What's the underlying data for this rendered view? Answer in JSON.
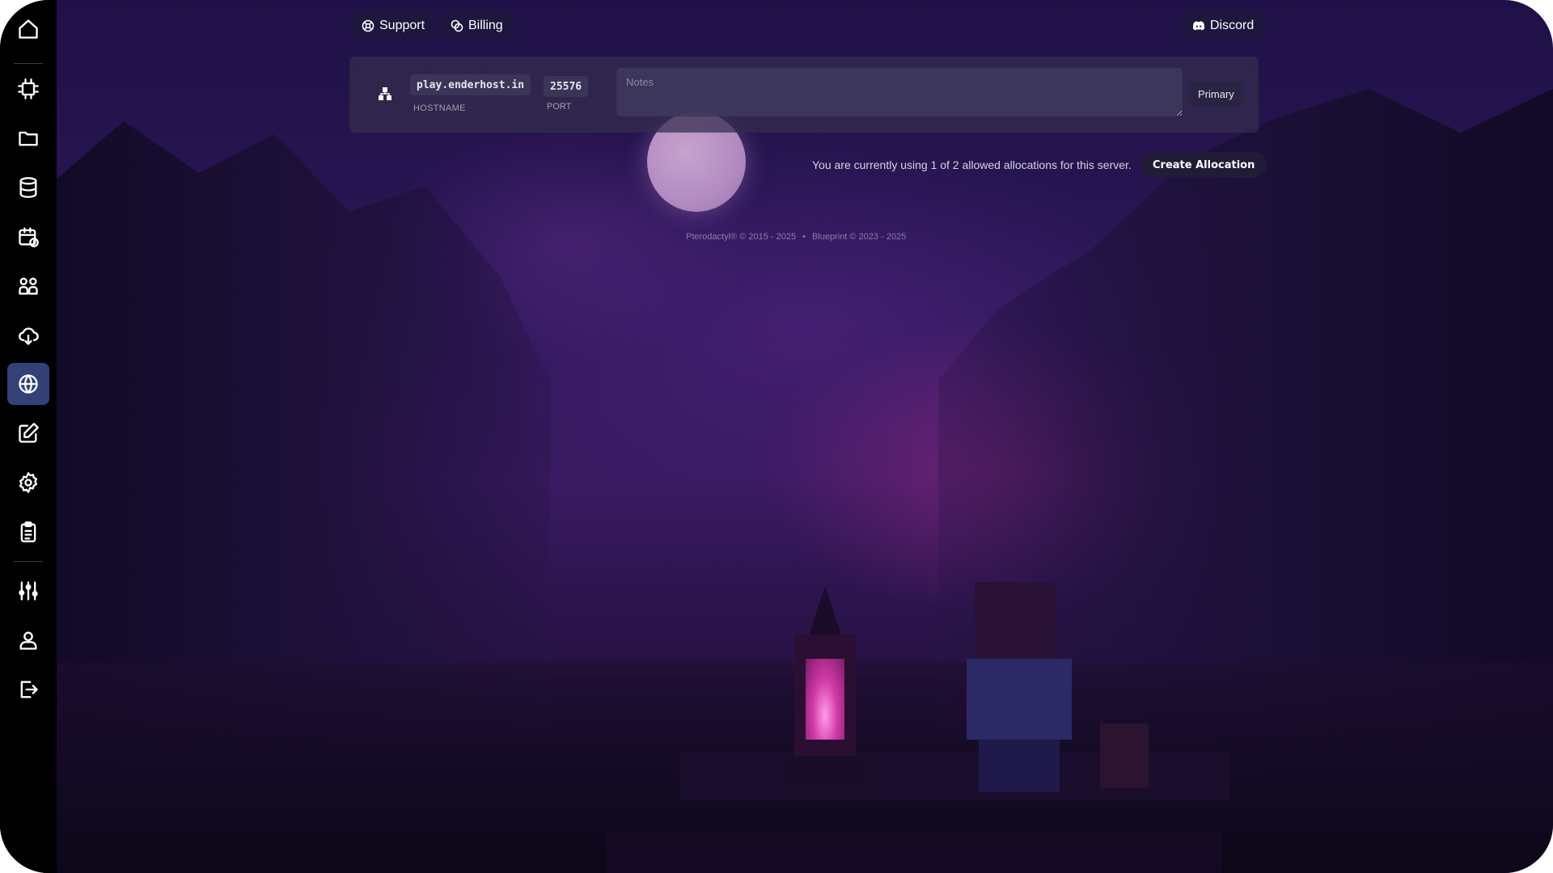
{
  "top_bar": {
    "support_label": "Support",
    "billing_label": "Billing",
    "discord_label": "Discord"
  },
  "sidebar": {
    "items": [
      {
        "icon": "home-icon"
      },
      {
        "icon": "cpu-icon"
      },
      {
        "icon": "folder-icon"
      },
      {
        "icon": "database-icon"
      },
      {
        "icon": "calendar-clock-icon"
      },
      {
        "icon": "users-icon"
      },
      {
        "icon": "cloud-download-icon"
      },
      {
        "icon": "globe-icon",
        "active": true
      },
      {
        "icon": "edit-icon"
      },
      {
        "icon": "gear-icon"
      },
      {
        "icon": "clipboard-icon"
      },
      {
        "icon": "sliders-icon"
      },
      {
        "icon": "user-icon"
      },
      {
        "icon": "logout-icon"
      }
    ],
    "active_color": "#33407a"
  },
  "allocation": {
    "hostname": "play.enderhost.in",
    "hostname_label": "HOSTNAME",
    "port": "25576",
    "port_label": "PORT",
    "notes_placeholder": "Notes",
    "badge": "Primary"
  },
  "usage": {
    "text": "You are currently using 1 of 2 allowed allocations for this server.",
    "create_button": "Create Allocation"
  },
  "footer": {
    "pterodactyl": "Pterodactyl® © 2015 - 2025",
    "separator": "•",
    "blueprint": "Blueprint © 2023 - 2025"
  }
}
